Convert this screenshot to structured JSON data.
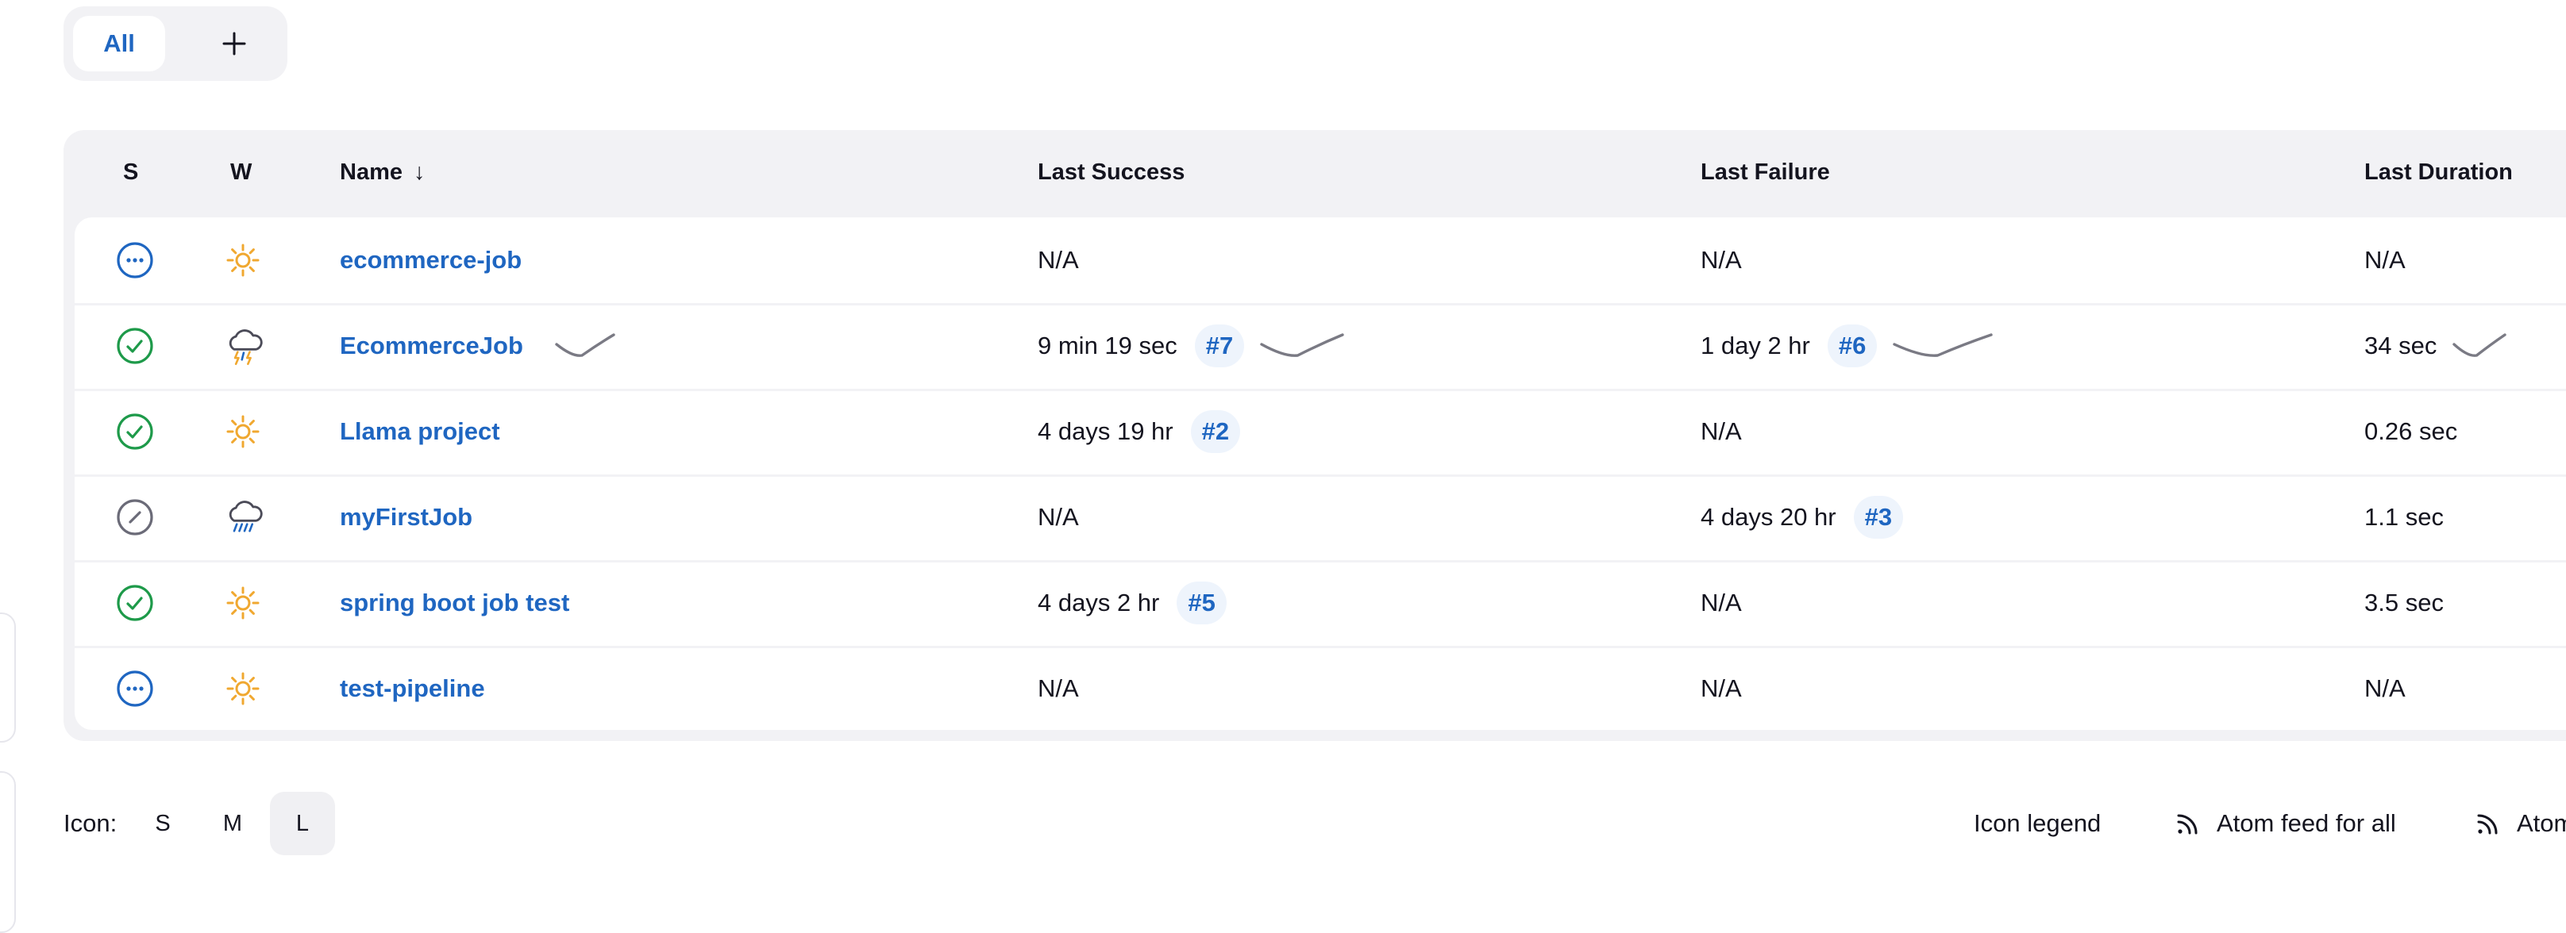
{
  "tabs": {
    "active_label": "All",
    "add_label": "+"
  },
  "columns": {
    "status": "S",
    "weather": "W",
    "name": "Name",
    "name_sort": "↓",
    "last_success": "Last Success",
    "last_failure": "Last Failure",
    "last_duration": "Last Duration"
  },
  "jobs": [
    {
      "status": "in-progress",
      "weather": "sunny",
      "name": "ecommerce-job",
      "last_success": "N/A",
      "success_build": "",
      "last_failure": "N/A",
      "failure_build": "",
      "last_duration": "N/A"
    },
    {
      "status": "success",
      "weather": "thunderstorm",
      "name": "EcommerceJob",
      "last_success": "9 min 19 sec",
      "success_build": "#7",
      "last_failure": "1 day 2 hr",
      "failure_build": "#6",
      "last_duration": "34 sec"
    },
    {
      "status": "success",
      "weather": "sunny",
      "name": "Llama project",
      "last_success": "4 days 19 hr",
      "success_build": "#2",
      "last_failure": "N/A",
      "failure_build": "",
      "last_duration": "0.26 sec"
    },
    {
      "status": "disabled",
      "weather": "rain",
      "name": "myFirstJob",
      "last_success": "N/A",
      "success_build": "",
      "last_failure": "4 days 20 hr",
      "failure_build": "#3",
      "last_duration": "1.1 sec"
    },
    {
      "status": "success",
      "weather": "sunny",
      "name": "spring boot job test",
      "last_success": "4 days 2 hr",
      "success_build": "#5",
      "last_failure": "N/A",
      "failure_build": "",
      "last_duration": "3.5 sec"
    },
    {
      "status": "in-progress",
      "weather": "sunny",
      "name": "test-pipeline",
      "last_success": "N/A",
      "success_build": "",
      "last_failure": "N/A",
      "failure_build": "",
      "last_duration": "N/A"
    }
  ],
  "footer": {
    "icon_label": "Icon:",
    "sizes": [
      "S",
      "M",
      "L"
    ],
    "active_size": "L",
    "legend_label": "Icon legend",
    "feed_all_label": "Atom feed for all",
    "feed_failures_label": "Atom"
  },
  "colors": {
    "link": "#1f66c1",
    "success": "#1e9a4a",
    "in_progress": "#1f66c1",
    "disabled": "#6b6b78",
    "sunny": "#f0a830",
    "header_bg": "#f2f2f5"
  }
}
